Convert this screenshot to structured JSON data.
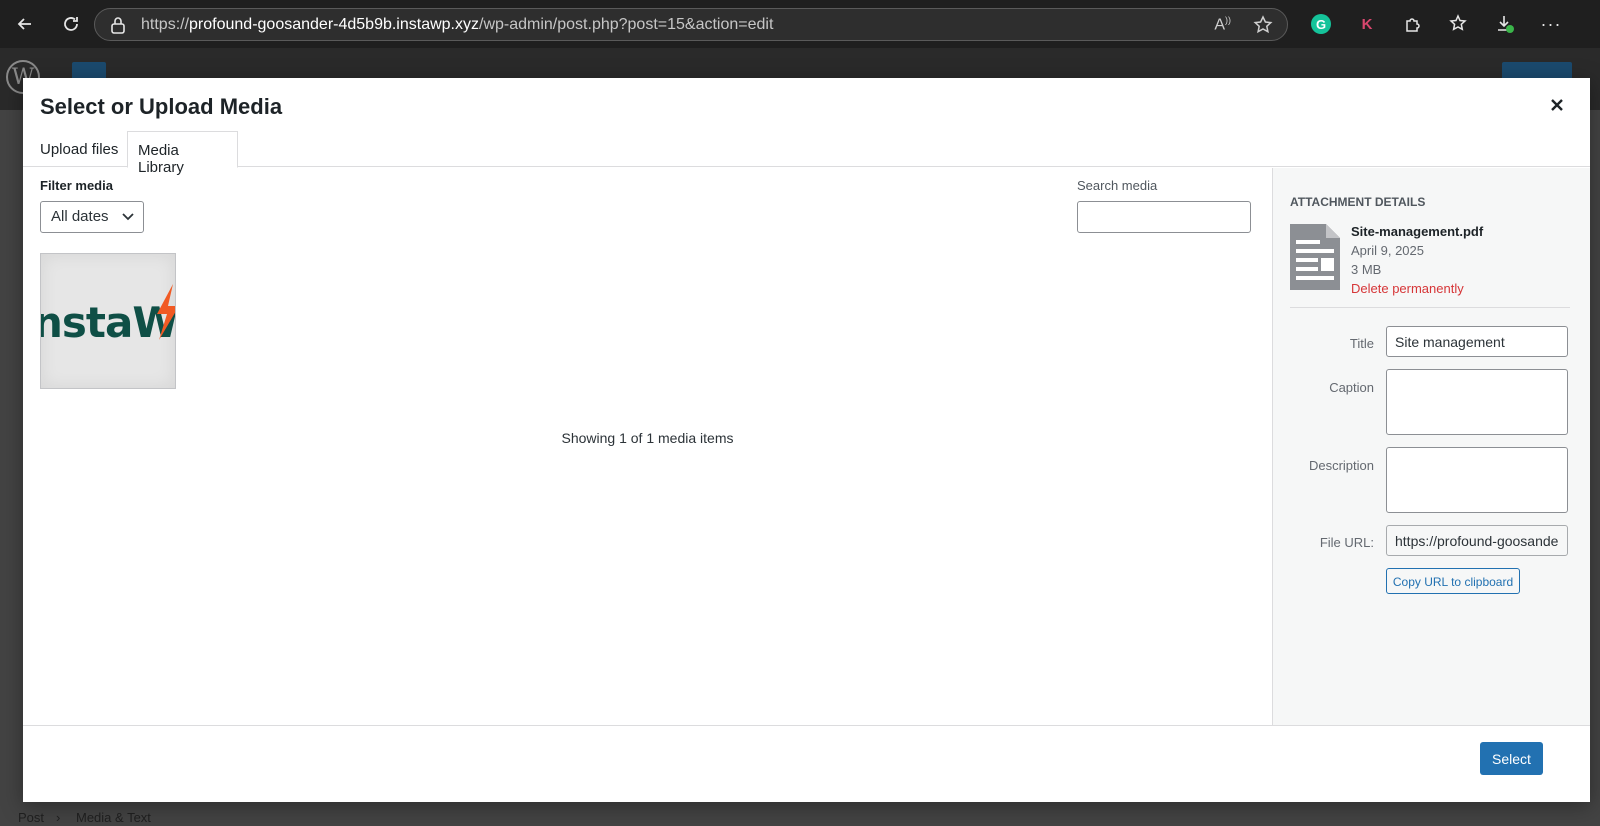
{
  "browser": {
    "url_prefix": "https://",
    "url_host": "profound-goosander-4d5b9b.instawp.xyz",
    "url_path": "/wp-admin/post.php?post=15&action=edit"
  },
  "extensions": {
    "k_label": "K"
  },
  "footer": {
    "breadcrumb_post": "Post",
    "breadcrumb_sep": "›",
    "breadcrumb_block": "Media & Text"
  },
  "modal": {
    "title": "Select or Upload Media",
    "tabs": [
      {
        "label": "Upload files"
      },
      {
        "label": "Media Library"
      }
    ],
    "filter_label": "Filter media",
    "date_filter_value": "All dates",
    "search_label": "Search media",
    "search_value": "",
    "thumbnail_text": "nstaW",
    "count_text": "Showing 1 of 1 media items",
    "select_button": "Select"
  },
  "attachment": {
    "heading": "Attachment Details",
    "filename": "Site-management.pdf",
    "date": "April 9, 2025",
    "size": "3 MB",
    "delete_link": "Delete permanently",
    "title_label": "Title",
    "title_value": "Site management",
    "caption_label": "Caption",
    "caption_value": "",
    "description_label": "Description",
    "description_value": "",
    "file_url_label": "File URL:",
    "file_url_value": "https://profound-goosande",
    "copy_button": "Copy URL to clipboard"
  },
  "colors": {
    "accent": "#2271b1",
    "danger": "#d63638",
    "brand_green": "#0f4f46",
    "brand_orange": "#f15a24"
  }
}
